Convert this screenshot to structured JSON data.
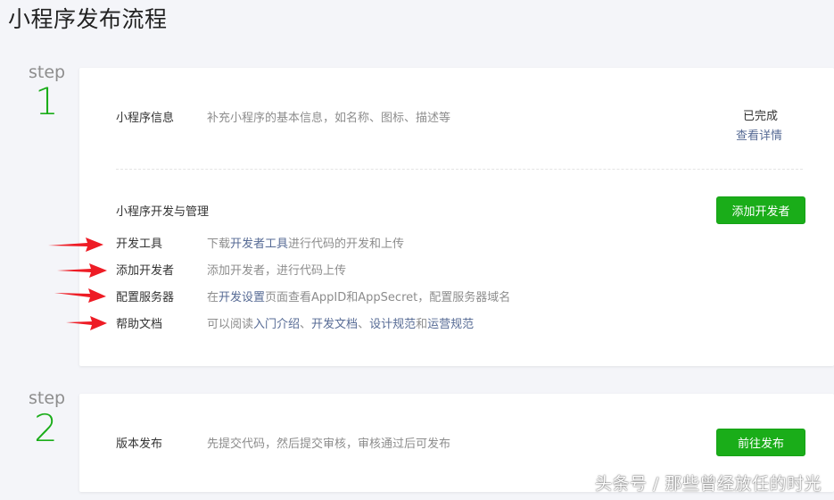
{
  "page_title": "小程序发布流程",
  "steps": [
    {
      "label": "step",
      "number": "1",
      "info": {
        "label": "小程序信息",
        "desc": "补充小程序的基本信息，如名称、图标、描述等",
        "status": "已完成",
        "detail_link": "查看详情"
      },
      "dev": {
        "title": "小程序开发与管理",
        "button": "添加开发者",
        "items": [
          {
            "label": "开发工具",
            "desc_pre": "下载",
            "link": "开发者工具",
            "desc_post": "进行代码的开发和上传"
          },
          {
            "label": "添加开发者",
            "desc": "添加开发者，进行代码上传"
          },
          {
            "label": "配置服务器",
            "desc_pre": "在",
            "link": "开发设置",
            "desc_post": "页面查看AppID和AppSecret，配置服务器域名"
          },
          {
            "label": "帮助文档",
            "desc_pre": "可以阅读",
            "link1": "入门介绍",
            "sep1": "、",
            "link2": "开发文档",
            "sep2": "、",
            "link3": "设计规范",
            "sep3": "和",
            "link4": "运营规范"
          }
        ]
      }
    },
    {
      "label": "step",
      "number": "2",
      "publish": {
        "label": "版本发布",
        "desc": "先提交代码，然后提交审核，审核通过后可发布",
        "button": "前往发布"
      }
    }
  ],
  "watermark": "头条号 / 那些曾经放任的时光",
  "colors": {
    "accent_green": "#1aad19",
    "link_blue": "#576b95",
    "arrow_red": "#ee1c25"
  }
}
